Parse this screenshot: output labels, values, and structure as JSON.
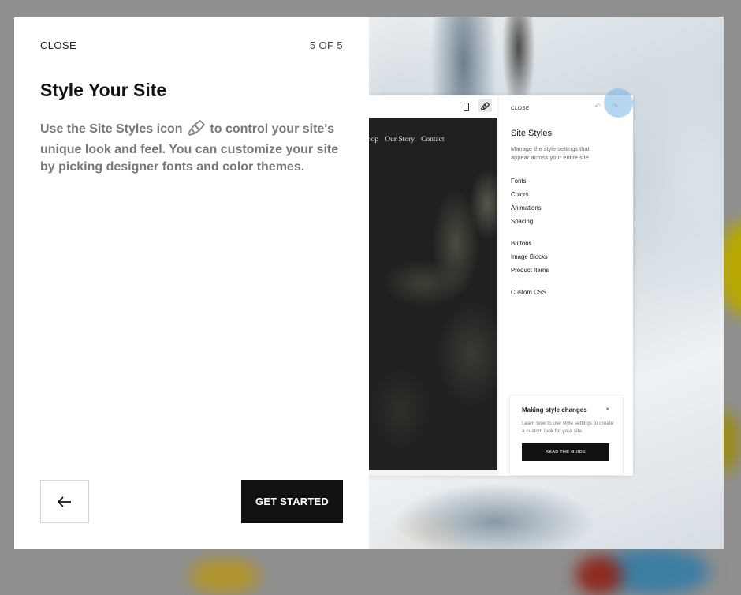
{
  "dialog": {
    "close_label": "CLOSE",
    "step_indicator": "5 OF 5",
    "title": "Style Your Site",
    "description_before_icon": "Use the Site Styles icon",
    "description_after_icon": "to control your site's unique look and feel. You can customize your site by picking designer fonts and color themes.",
    "back_icon": "arrow-left-icon",
    "primary_button": "GET STARTED"
  },
  "illustration": {
    "nav_links": [
      "hop",
      "Our Story",
      "Contact"
    ],
    "panel": {
      "close_label": "CLOSE",
      "title": "Site Styles",
      "subtitle": "Manage the style settings that appear across your entire site.",
      "groups": [
        [
          "Fonts",
          "Colors",
          "Animations",
          "Spacing"
        ],
        [
          "Buttons",
          "Image Blocks",
          "Product Items"
        ],
        [
          "Custom CSS"
        ]
      ]
    },
    "tip": {
      "title": "Making style changes",
      "close_symbol": "×",
      "body": "Learn how to use style settings to create a custom look for your site.",
      "button": "READ THE GUIDE"
    }
  },
  "colors": {
    "primary_button_bg": "#111111",
    "overlay": "#8f8f8f",
    "highlight": "#78b4e6"
  }
}
